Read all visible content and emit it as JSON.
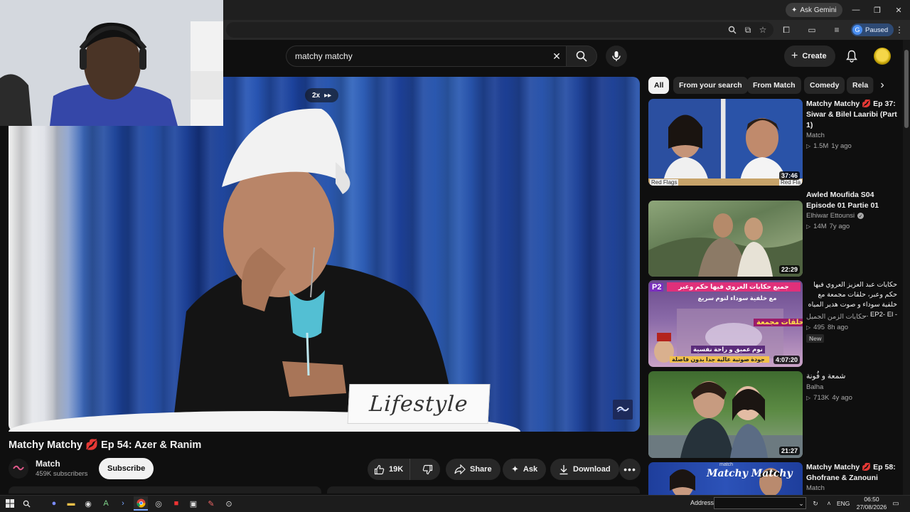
{
  "browser": {
    "gemini_label": "Ask Gemini",
    "profile_status": "Paused",
    "profile_initial": "G"
  },
  "header": {
    "search_value": "matchy matchy",
    "create_label": "Create"
  },
  "player": {
    "speed_label": "2x",
    "card_text": "Lifestyle"
  },
  "video": {
    "title": "Matchy Matchy 💋 Ep 54: Azer & Ranim",
    "channel": "Match",
    "subscribers": "459K subscribers",
    "subscribe_label": "Subscribe",
    "likes": "19K",
    "share_label": "Share",
    "ask_label": "Ask",
    "download_label": "Download"
  },
  "chips": [
    "All",
    "From your search",
    "From Match",
    "Comedy",
    "Rela"
  ],
  "recommendations": [
    {
      "title": "Matchy Matchy 💋 Ep 37: Siwar & Bilel Laaribi (Part 1)",
      "channel": "Match",
      "views": "1.5M",
      "age": "1y ago",
      "duration": "37:46",
      "verified": false,
      "new": false
    },
    {
      "title": "Awled Moufida S04 Episode 01 Partie 01",
      "channel": "Elhiwar Ettounsi",
      "views": "14M",
      "age": "7y ago",
      "duration": "22:29",
      "verified": true,
      "new": false
    },
    {
      "title": "حكايات عبد العزيز العروي فيها حكم وعبر، حلقات مجمعة مع خلفية سوداء و صوت هدير المياه - EP2- El ...",
      "channel": "حكايات الزمن الجميل",
      "views": "495",
      "age": "8h ago",
      "duration": "4:07:20",
      "verified": false,
      "new": true,
      "new_label": "New"
    },
    {
      "title": "شمعة و فُونة",
      "channel": "Balha",
      "views": "713K",
      "age": "4y ago",
      "duration": "21:27",
      "verified": false,
      "new": false
    },
    {
      "title": "Matchy Matchy 💋 Ep 58: Ghofrane & Zanouni",
      "channel": "Match",
      "views": "",
      "age": "",
      "duration": "",
      "verified": false,
      "new": false
    }
  ],
  "thumb_texts": {
    "rec1_left": "Red Flags",
    "rec1_right": "Red Fla",
    "rec3_badge": "P2",
    "rec3_banner": "جميع حكايات العروي فيها حكم وعبر",
    "rec3_sub": "مع خلفية سوداء لنوم سريع",
    "rec3_tag": "حلقات مجمعة",
    "rec3_footer": "نوم عميق و راحة نفسية",
    "rec3_footer2": "جودة صوتية عالية جدا بدون فاصلة",
    "rec5_logo": "Matchy Matchy",
    "rec5_brand": "match"
  },
  "taskbar": {
    "address_label": "Address",
    "language": "ENG",
    "time": "06:50",
    "date": "27/08/2026"
  }
}
